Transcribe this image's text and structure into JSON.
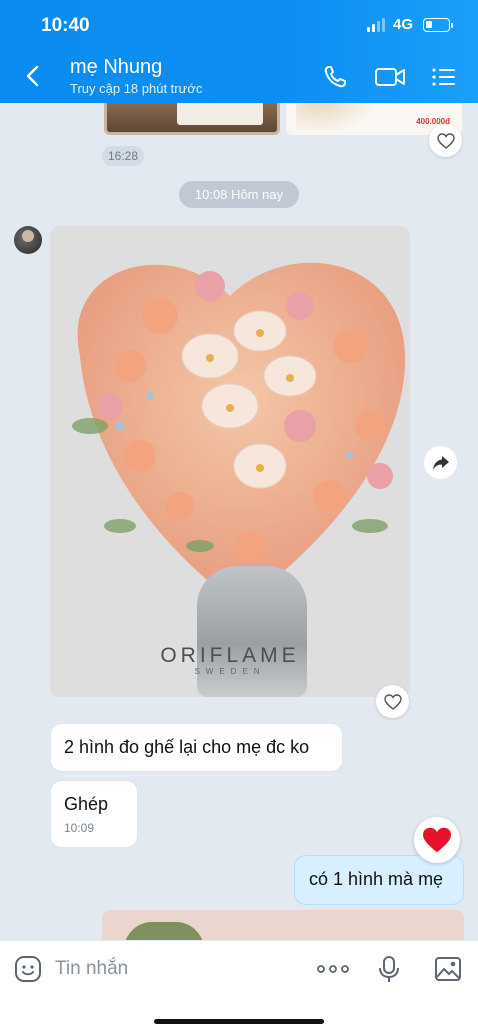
{
  "status_bar": {
    "time": "10:40",
    "network": "4G"
  },
  "header": {
    "contact_name": "mẹ Nhung",
    "last_seen": "Truy cập 18 phút trước"
  },
  "previous": {
    "time": "16:28",
    "price_text": "400.000đ"
  },
  "date_divider": "10:08 Hôm nay",
  "photo": {
    "brand": "ORIFLAME",
    "brand_sub": "SWEDEN"
  },
  "messages": [
    {
      "id": "m1",
      "text": "2 hình đo ghế lại cho mẹ đc ko",
      "sender": "other"
    },
    {
      "id": "m2",
      "text": "Ghép",
      "time": "10:09",
      "sender": "other"
    },
    {
      "id": "m3",
      "text": "có 1 hình mà mẹ",
      "sender": "me",
      "reaction": "heart"
    }
  ],
  "composer": {
    "placeholder": "Tin nhắn"
  },
  "colors": {
    "header": "#0a8cf0",
    "chat_bg": "#e3e9f0",
    "my_bubble": "#d7effe",
    "heart": "#e8112d"
  }
}
